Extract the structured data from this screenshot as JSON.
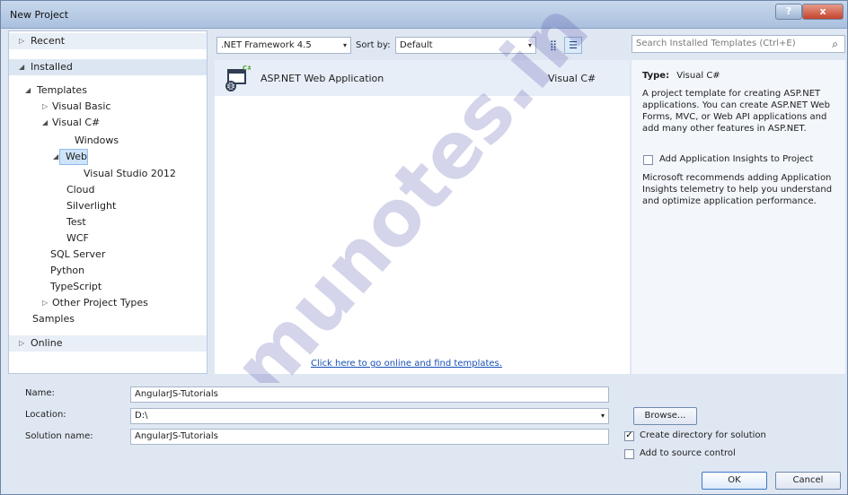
{
  "window": {
    "title": "New Project",
    "help": "?",
    "close": "x"
  },
  "navigation": {
    "recent": "Recent",
    "installed": "Installed",
    "templates": "Templates",
    "visual_basic": "Visual Basic",
    "visual_csharp": "Visual C#",
    "windows": "Windows",
    "web": "Web",
    "visual_studio_2012": "Visual Studio 2012",
    "cloud": "Cloud",
    "silverlight": "Silverlight",
    "test": "Test",
    "wcf": "WCF",
    "sql_server": "SQL Server",
    "python": "Python",
    "typescript": "TypeScript",
    "other_project_types": "Other Project Types",
    "samples": "Samples",
    "online": "Online"
  },
  "toolbar": {
    "framework": ".NET Framework 4.5",
    "sort_by_label": "Sort by:",
    "sort_by_value": "Default"
  },
  "search": {
    "placeholder": "Search Installed Templates (Ctrl+E)"
  },
  "template_list": {
    "name": "ASP.NET Web Application",
    "language": "Visual C#",
    "online_link": "Click here to go online and find templates."
  },
  "details": {
    "type_label": "Type:",
    "type_value": "Visual C#",
    "description": "A project template for creating ASP.NET applications. You can create ASP.NET Web Forms, MVC, or Web API applications and add many other features in ASP.NET.",
    "insights_label": "Add Application Insights to Project",
    "insights_description": "Microsoft recommends adding Application Insights telemetry to help you understand and optimize application performance."
  },
  "form": {
    "name_label": "Name:",
    "name_value": "AngularJS-Tutorials",
    "location_label": "Location:",
    "location_value": "D:\\",
    "solution_label": "Solution name:",
    "solution_value": "AngularJS-Tutorials",
    "browse": "Browse...",
    "create_directory": "Create directory for solution",
    "add_source_control": "Add to source control",
    "ok": "OK",
    "cancel": "Cancel"
  },
  "watermark": "munotes.in",
  "icons": {
    "tree_collapsed": "triangle-right-icon",
    "tree_expanded": "triangle-down-icon",
    "dropdown": "chevron-down-icon",
    "search": "search-icon",
    "small_icons_view": "small-icons-view-icon",
    "list_view": "list-view-icon",
    "web_project": "asp-net-web-application-icon"
  }
}
